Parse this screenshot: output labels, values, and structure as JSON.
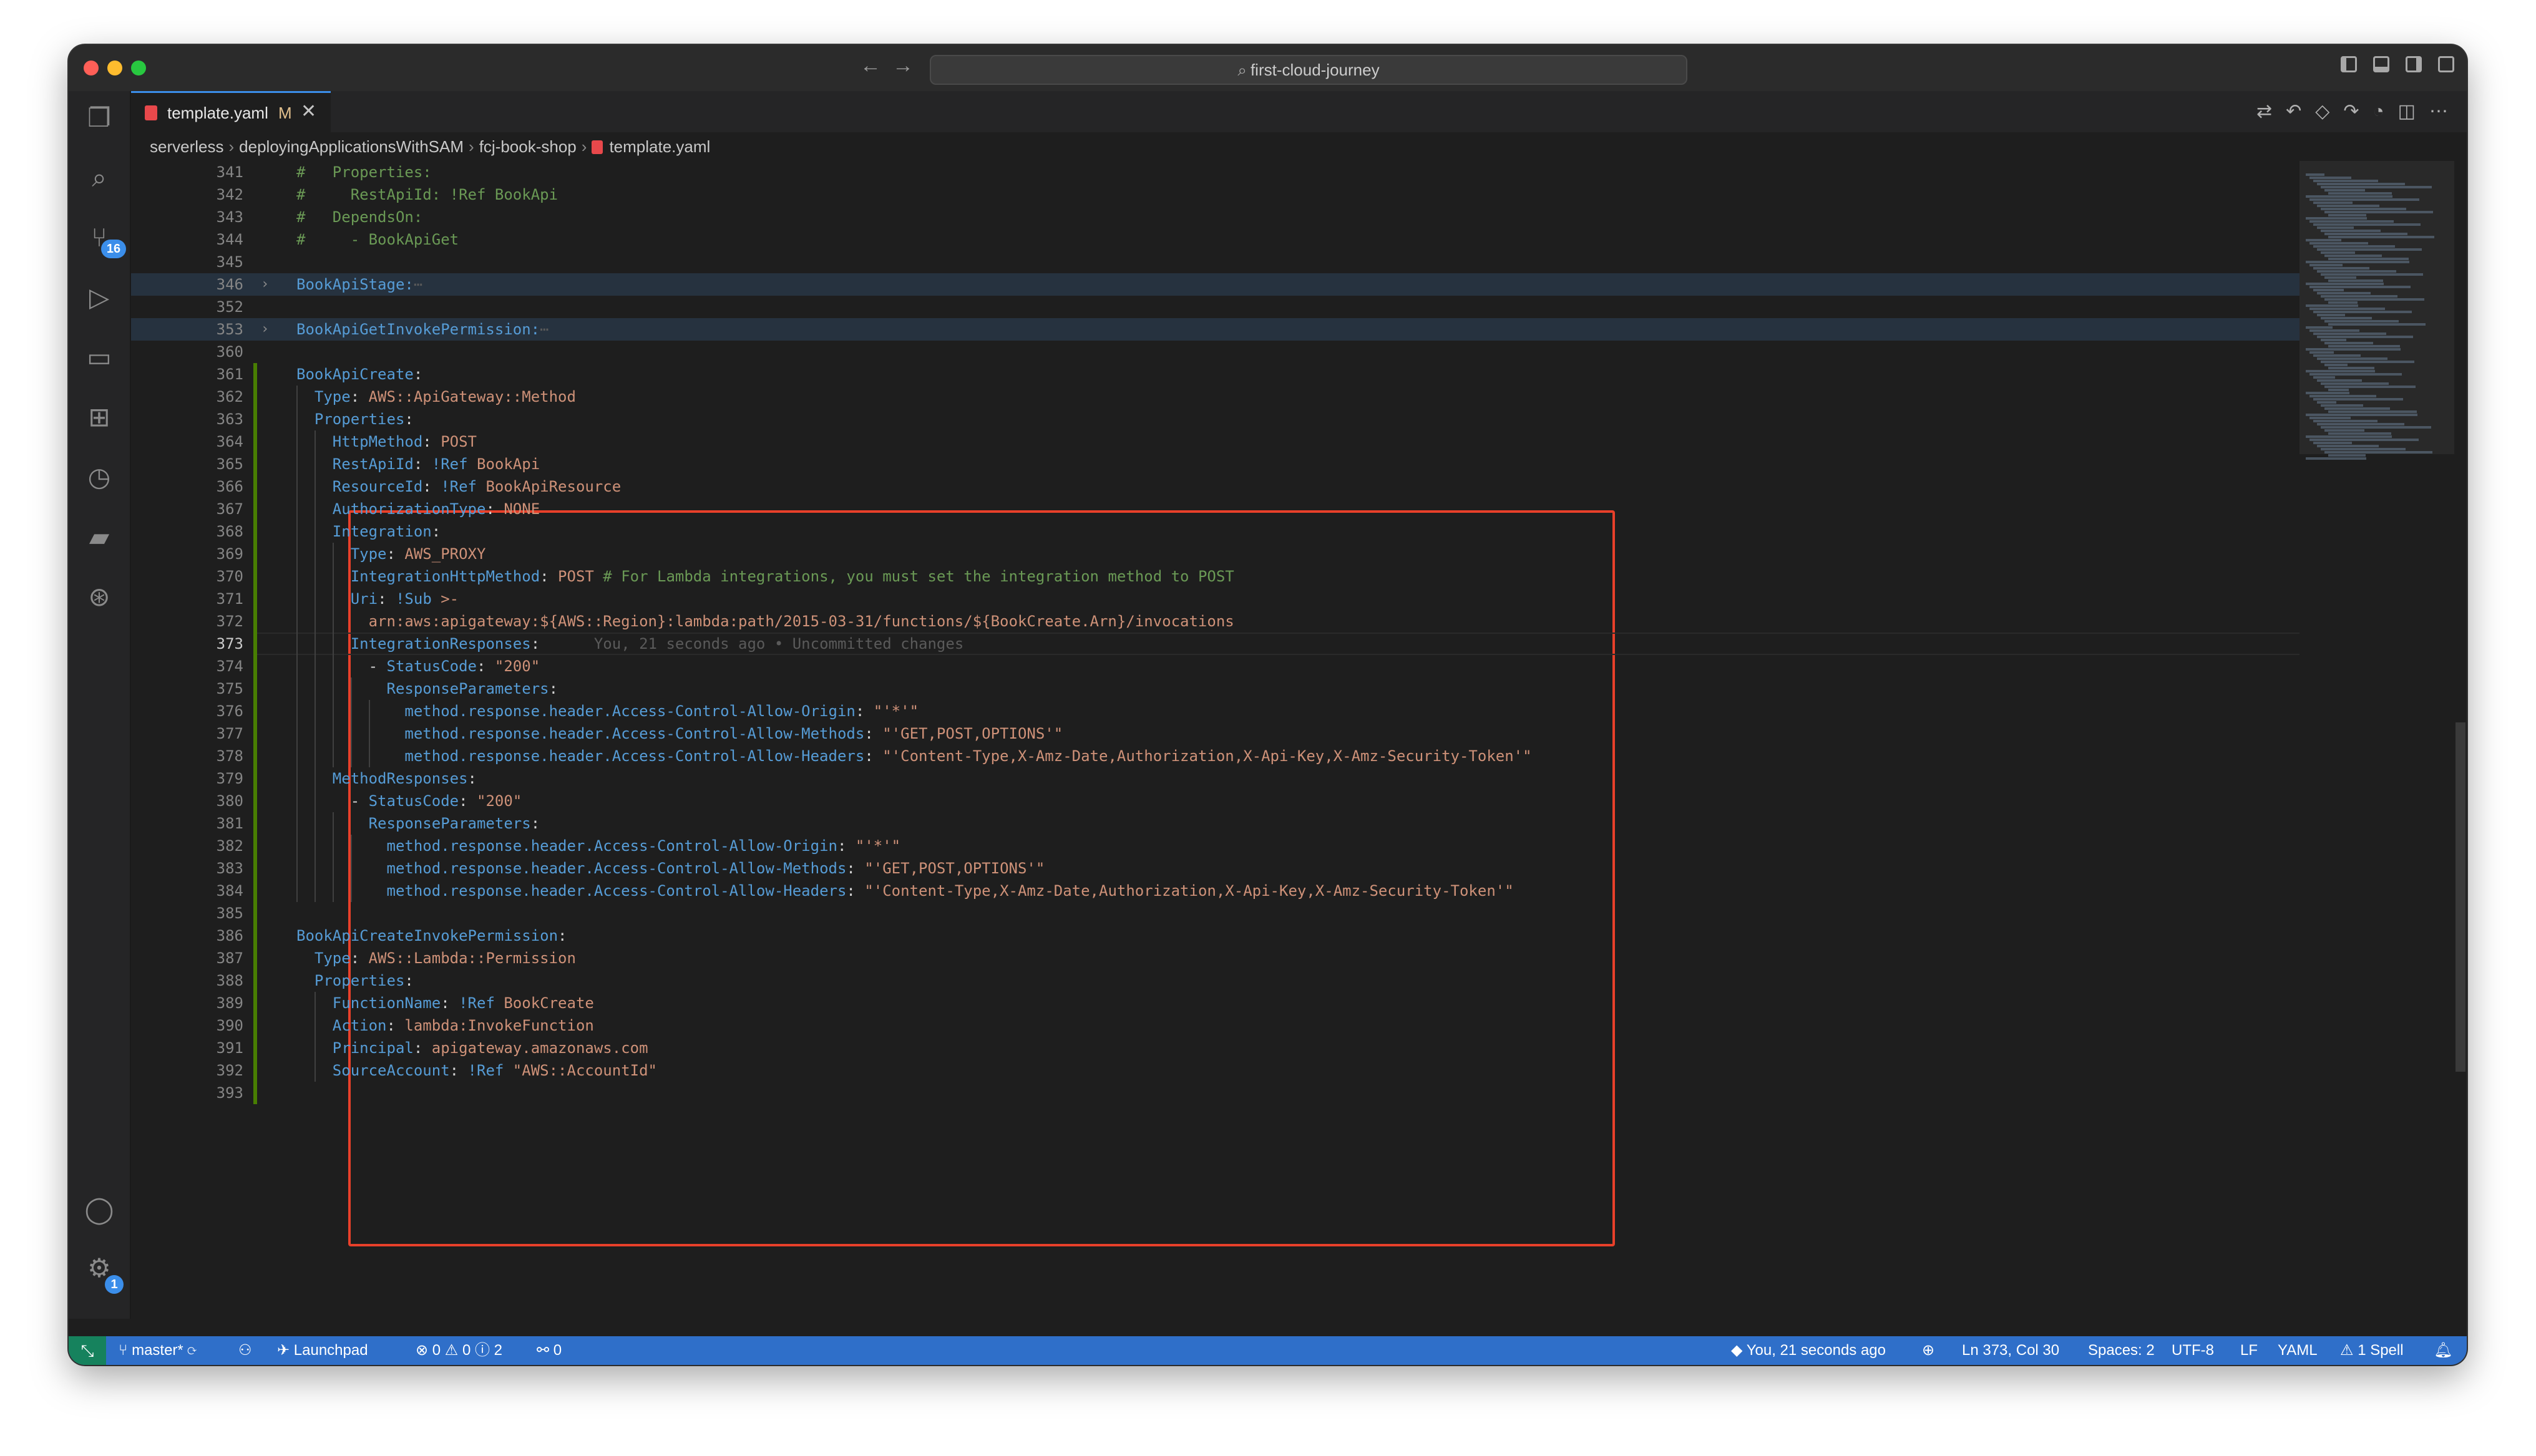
{
  "window": {
    "title": "first-cloud-journey"
  },
  "nav": {
    "back": "←",
    "forward": "→"
  },
  "tab": {
    "label": "template.yaml",
    "modified": "M",
    "close": "✕"
  },
  "breadcrumb": [
    "serverless",
    "deployingApplicationsWithSAM",
    "fcj-book-shop",
    "template.yaml"
  ],
  "activity": {
    "scm_badge": "16",
    "settings_badge": "1"
  },
  "code_lines": [
    {
      "n": "341",
      "t": "#   Properties:",
      "cls": "c",
      "y": 0
    },
    {
      "n": "342",
      "t": "#     RestApiId: !Ref BookApi",
      "cls": "c",
      "y": 1
    },
    {
      "n": "343",
      "t": "#   DependsOn:",
      "cls": "c",
      "y": 2
    },
    {
      "n": "344",
      "t": "#     - BookApiGet",
      "cls": "c",
      "y": 3
    },
    {
      "n": "345",
      "t": "",
      "cls": "",
      "y": 4
    },
    {
      "n": "346",
      "t": "BookApiStage:",
      "tail": "⋯",
      "cls": "k",
      "folded": true,
      "y": 5
    },
    {
      "n": "352",
      "t": "",
      "cls": "",
      "y": 6
    },
    {
      "n": "353",
      "t": "BookApiGetInvokePermission:",
      "tail": "⋯",
      "cls": "k",
      "folded": true,
      "y": 7
    },
    {
      "n": "360",
      "t": "",
      "cls": "",
      "y": 8
    },
    {
      "n": "361",
      "key": "BookApiCreate",
      "val": "",
      "indent": 0,
      "y": 9
    },
    {
      "n": "362",
      "key": "Type",
      "val": "AWS::ApiGateway::Method",
      "indent": 1,
      "y": 10
    },
    {
      "n": "363",
      "key": "Properties",
      "val": "",
      "indent": 1,
      "y": 11
    },
    {
      "n": "364",
      "key": "HttpMethod",
      "val": "POST",
      "indent": 2,
      "y": 12
    },
    {
      "n": "365",
      "key": "RestApiId",
      "tag": "!Ref",
      "val": "BookApi",
      "indent": 2,
      "y": 13
    },
    {
      "n": "366",
      "key": "ResourceId",
      "tag": "!Ref",
      "val": "BookApiResource",
      "indent": 2,
      "y": 14
    },
    {
      "n": "367",
      "key": "AuthorizationType",
      "val": "NONE",
      "indent": 2,
      "y": 15
    },
    {
      "n": "368",
      "key": "Integration",
      "val": "",
      "indent": 2,
      "y": 16
    },
    {
      "n": "369",
      "key": "Type",
      "val": "AWS_PROXY",
      "indent": 3,
      "y": 17
    },
    {
      "n": "370",
      "key": "IntegrationHttpMethod",
      "val": "POST",
      "comment": "# For Lambda integrations, you must set the integration method to POST",
      "indent": 3,
      "y": 18
    },
    {
      "n": "371",
      "key": "Uri",
      "tag": "!Sub",
      "val": ">-",
      "indent": 3,
      "y": 19
    },
    {
      "n": "372",
      "raw": "arn:aws:apigateway:${AWS::Region}:lambda:path/2015-03-31/functions/${BookCreate.Arn}/invocations",
      "indent": 4,
      "y": 20
    },
    {
      "n": "373",
      "key": "IntegrationResponses",
      "val": "",
      "blame": "You, 21 seconds ago • Uncommitted changes",
      "indent": 3,
      "active": true,
      "y": 21
    },
    {
      "n": "374",
      "dash": true,
      "key": "StatusCode",
      "val": "\"200\"",
      "indent": 4,
      "y": 22
    },
    {
      "n": "375",
      "key": "ResponseParameters",
      "val": "",
      "indent": 5,
      "y": 23
    },
    {
      "n": "376",
      "key": "method.response.header.Access-Control-Allow-Origin",
      "val": "\"'*'\"",
      "indent": 6,
      "y": 24
    },
    {
      "n": "377",
      "key": "method.response.header.Access-Control-Allow-Methods",
      "val": "\"'GET,POST,OPTIONS'\"",
      "indent": 6,
      "y": 25
    },
    {
      "n": "378",
      "key": "method.response.header.Access-Control-Allow-Headers",
      "val": "\"'Content-Type,X-Amz-Date,Authorization,X-Api-Key,X-Amz-Security-Token'\"",
      "indent": 6,
      "y": 26
    },
    {
      "n": "379",
      "key": "MethodResponses",
      "val": "",
      "indent": 2,
      "y": 27
    },
    {
      "n": "380",
      "dash": true,
      "key": "StatusCode",
      "val": "\"200\"",
      "indent": 3,
      "y": 28
    },
    {
      "n": "381",
      "key": "ResponseParameters",
      "val": "",
      "indent": 4,
      "y": 29
    },
    {
      "n": "382",
      "key": "method.response.header.Access-Control-Allow-Origin",
      "val": "\"'*'\"",
      "indent": 5,
      "y": 30
    },
    {
      "n": "383",
      "key": "method.response.header.Access-Control-Allow-Methods",
      "val": "\"'GET,POST,OPTIONS'\"",
      "indent": 5,
      "y": 31
    },
    {
      "n": "384",
      "key": "method.response.header.Access-Control-Allow-Headers",
      "val": "\"'Content-Type,X-Amz-Date,Authorization,X-Api-Key,X-Amz-Security-Token'\"",
      "indent": 5,
      "y": 32
    },
    {
      "n": "385",
      "t": "",
      "cls": "",
      "y": 33
    },
    {
      "n": "386",
      "key": "BookApiCreateInvokePermission",
      "val": "",
      "indent": 0,
      "y": 34
    },
    {
      "n": "387",
      "key": "Type",
      "val": "AWS::Lambda::Permission",
      "indent": 1,
      "y": 35
    },
    {
      "n": "388",
      "key": "Properties",
      "val": "",
      "indent": 1,
      "y": 36
    },
    {
      "n": "389",
      "key": "FunctionName",
      "tag": "!Ref",
      "val": "BookCreate",
      "indent": 2,
      "y": 37
    },
    {
      "n": "390",
      "key": "Action",
      "val": "lambda:InvokeFunction",
      "indent": 2,
      "y": 38
    },
    {
      "n": "391",
      "key": "Principal",
      "val": "apigateway.amazonaws.com",
      "indent": 2,
      "y": 39
    },
    {
      "n": "392",
      "key": "SourceAccount",
      "tag": "!Ref",
      "val": "\"AWS::AccountId\"",
      "indent": 2,
      "y": 40
    },
    {
      "n": "393",
      "t": "",
      "cls": "",
      "y": 41
    }
  ],
  "status": {
    "branch": "master*",
    "launchpad": "Launchpad",
    "problems": "⊗ 0 ⚠ 0 ⓘ 2",
    "ports": "0",
    "blame": "You, 21 seconds ago",
    "position": "Ln 373, Col 30",
    "spaces": "Spaces: 2",
    "encoding": "UTF-8",
    "eol": "LF",
    "language": "YAML",
    "spell": "1 Spell"
  },
  "colors": {
    "accent": "#3b8eea",
    "statusbar": "#2f6fc9",
    "highlight_box": "#e8402a"
  }
}
